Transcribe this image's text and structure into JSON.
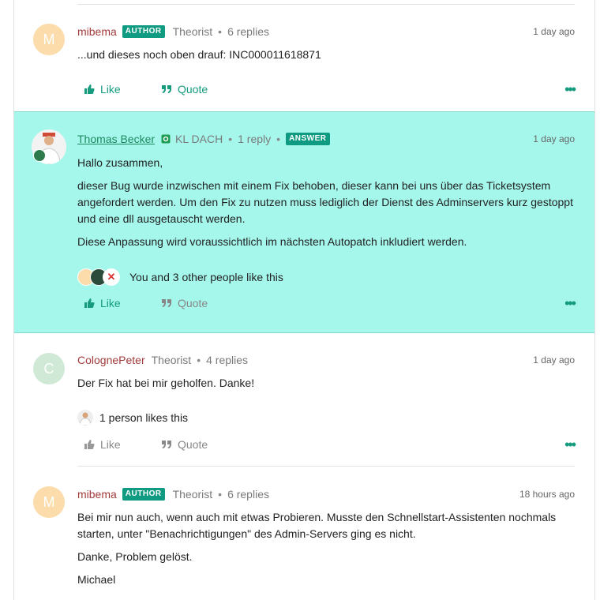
{
  "posts": [
    {
      "avatar_letter": "M",
      "username": "mibema",
      "badge": "AUTHOR",
      "rank": "Theorist",
      "replies": "6 replies",
      "time": "1 day ago",
      "body": [
        "...und dieses noch oben drauf:  INC000011618871"
      ],
      "like_label": "Like",
      "quote_label": "Quote"
    },
    {
      "username": "Thomas Becker",
      "rank": "KL DACH",
      "replies": "1 reply",
      "badge": "ANSWER",
      "time": "1 day ago",
      "body": [
        "Hallo zusammen,",
        "dieser Bug wurde inzwischen mit einem Fix behoben, dieser kann bei uns über das Ticketsystem angefordert werden. Um den Fix zu nutzen muss lediglich der Dienst des Adminservers kurz gestoppt und eine dll ausgetauscht werden.",
        "Diese Anpassung wird voraussichtlich im nächsten Autopatch inkludiert werden."
      ],
      "likes_text": "You and 3 other people like this",
      "like_label": "Like",
      "quote_label": "Quote"
    },
    {
      "avatar_letter": "C",
      "username": "ColognePeter",
      "rank": "Theorist",
      "replies": "4 replies",
      "time": "1 day ago",
      "body": [
        "Der Fix hat bei mir geholfen. Danke!"
      ],
      "likes_text": "1 person likes this",
      "like_label": "Like",
      "quote_label": "Quote"
    },
    {
      "avatar_letter": "M",
      "username": "mibema",
      "badge": "AUTHOR",
      "rank": "Theorist",
      "replies": "6 replies",
      "time": "18 hours ago",
      "body": [
        "Bei mir nun auch, wenn auch mit etwas Probieren. Musste den Schnellstart-Assistenten nochmals starten, unter \"Benachrichtigungen\" des Admin-Servers ging es nicht.",
        "Danke, Problem gelöst.",
        "Michael"
      ]
    }
  ],
  "colors": {
    "accent": "#169b7f",
    "answer_highlight": "#a5f7ec",
    "username_red": "#a33a3a"
  },
  "icons": [
    "thumbs-up-icon",
    "quote-icon",
    "more-icon",
    "online-status-icon"
  ]
}
